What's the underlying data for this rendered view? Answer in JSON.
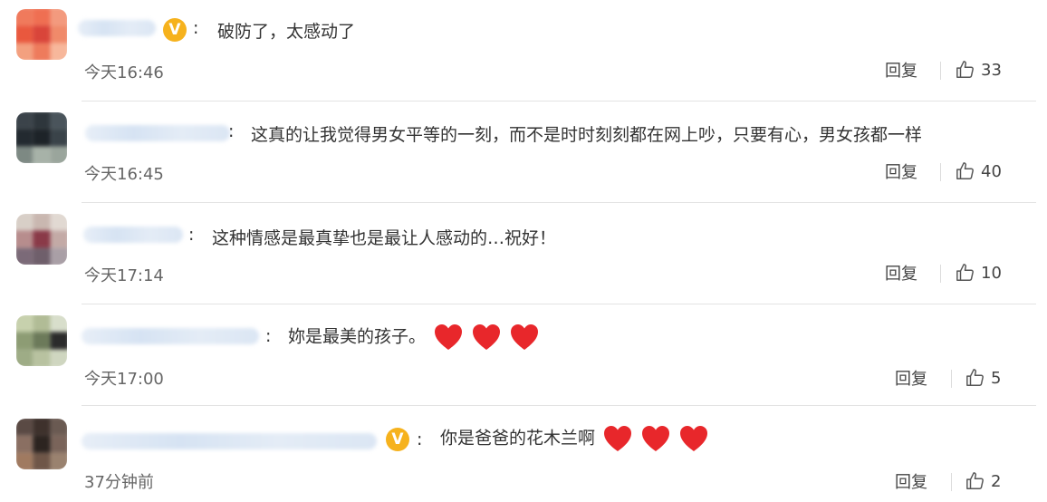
{
  "colors": {
    "heart": "#e8272b",
    "badge": "#f6b21d",
    "divider": "#e3e3e3"
  },
  "icons": {
    "verified": "v-badge",
    "like": "thumbs-up-icon",
    "heart": "heart-emoji"
  },
  "comments": [
    {
      "badge_text": "V",
      "separator": ":",
      "text": "破防了，太感动了",
      "time": "今天16:46",
      "reply": "回复",
      "likes": "33",
      "hearts": 0,
      "verified": true
    },
    {
      "separator": ":",
      "text": "这真的让我觉得男女平等的一刻，而不是时时刻刻都在网上吵，只要有心，男女孩都一样",
      "time": "今天16:45",
      "reply": "回复",
      "likes": "40",
      "hearts": 0,
      "verified": false
    },
    {
      "separator": ":",
      "text": "这种情感是最真挚也是最让人感动的…祝好！",
      "time": "今天17:14",
      "reply": "回复",
      "likes": "10",
      "hearts": 0,
      "verified": false
    },
    {
      "separator": ":",
      "text": "妳是最美的孩子。",
      "time": "今天17:00",
      "reply": "回复",
      "likes": "5",
      "hearts": 3,
      "verified": false
    },
    {
      "badge_text": "V",
      "separator": ":",
      "text": "你是爸爸的花木兰啊",
      "time": "37分钟前",
      "reply": "回复",
      "likes": "2",
      "hearts": 3,
      "verified": true
    }
  ]
}
